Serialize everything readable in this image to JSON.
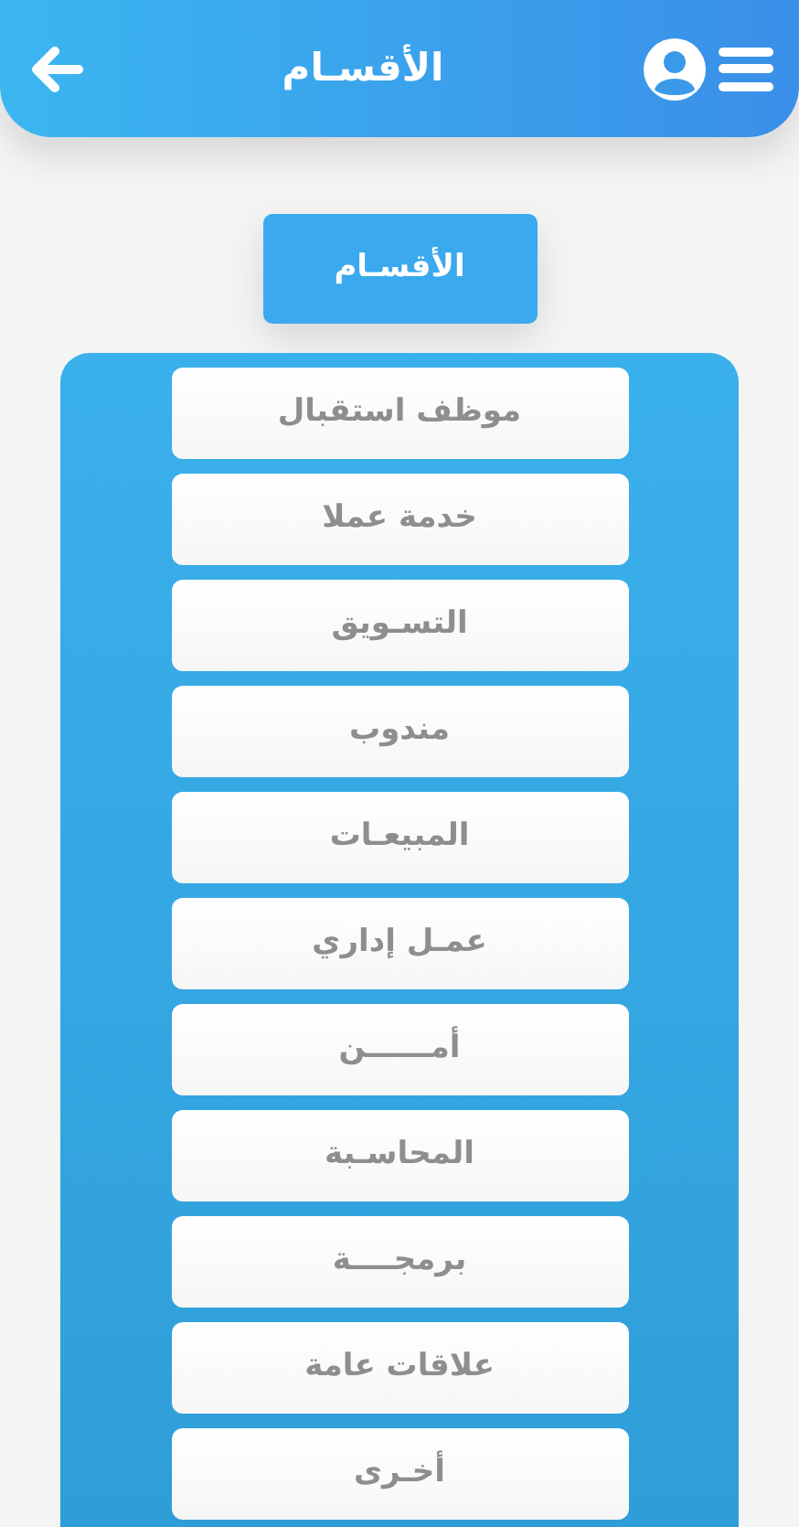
{
  "header": {
    "title": "الأقسـام"
  },
  "section_button": {
    "label": "الأقسـام"
  },
  "categories": [
    {
      "label": "موظف استقبال"
    },
    {
      "label": "خدمة عملا"
    },
    {
      "label": "التسـويق"
    },
    {
      "label": "مندوب"
    },
    {
      "label": "المبيعـات"
    },
    {
      "label": "عمـل إداري"
    },
    {
      "label": "أمــــــن"
    },
    {
      "label": "المحاسـبة"
    },
    {
      "label": "برمجــــة"
    },
    {
      "label": "علاقات عامة"
    },
    {
      "label": "أخـرى"
    }
  ]
}
